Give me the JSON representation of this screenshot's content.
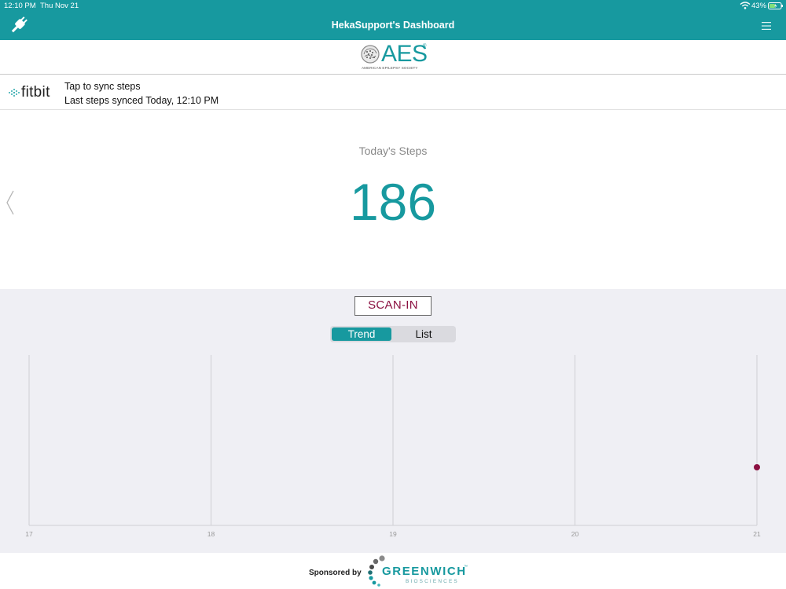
{
  "status_bar": {
    "time": "12:10 PM",
    "date": "Thu Nov 21",
    "battery": "43%"
  },
  "header": {
    "title": "HekaSupport's Dashboard",
    "background": "#17999f",
    "left_icon": "plug-icon",
    "right_icon": "hamburger-menu-icon"
  },
  "aes_logo": {
    "wordmark": "AES",
    "registered": "®",
    "subtitle": "AMERICAN EPILEPSY SOCIETY"
  },
  "fitbit": {
    "wordmark": "fitbit",
    "line1": "Tap to sync steps",
    "line2": "Last steps synced Today, 12:10 PM"
  },
  "steps": {
    "label": "Today's Steps",
    "value": "186",
    "prev_icon": "chevron-left-icon"
  },
  "scan_button": "SCAN-IN",
  "view_toggle": {
    "options": [
      "Trend",
      "List"
    ],
    "selected": "Trend"
  },
  "accent_color": "#17999f",
  "scan_color": "#8b1041",
  "chart_data": {
    "type": "scatter",
    "x_ticks": [
      "17",
      "18",
      "19",
      "20",
      "21"
    ],
    "points": [
      {
        "x": 21,
        "y": 186
      }
    ],
    "point_color": "#8b1041",
    "grid": true
  },
  "footer": {
    "sponsored_label": "Sponsored by",
    "sponsor_name": "GREENWICH",
    "sponsor_tm": "™",
    "sponsor_sub": "BIOSCIENCES"
  }
}
